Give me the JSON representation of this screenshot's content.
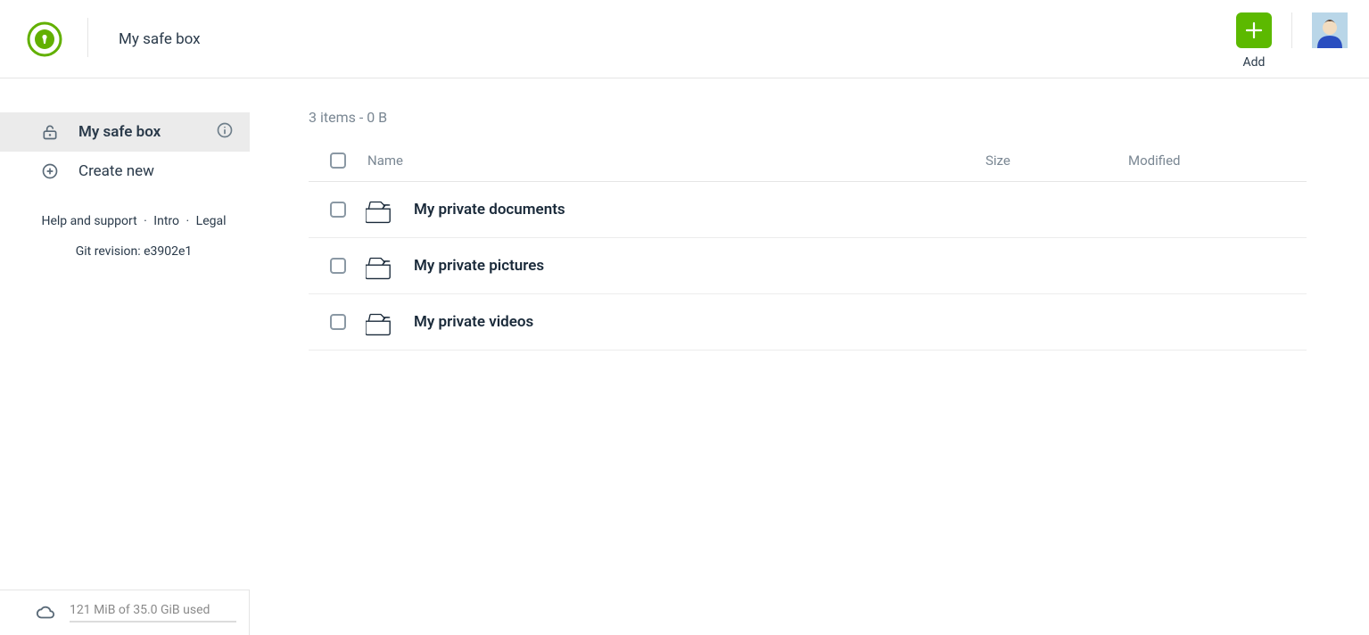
{
  "header": {
    "title": "My safe box",
    "add_label": "Add"
  },
  "sidebar": {
    "items": [
      {
        "label": "My safe box"
      },
      {
        "label": "Create new"
      }
    ],
    "help_label": "Help and support",
    "intro_label": "Intro",
    "legal_label": "Legal",
    "git_label": "Git revision: e3902e1"
  },
  "storage": {
    "text": "121 MiB of 35.0 GiB used"
  },
  "main": {
    "summary": "3 items - 0 B",
    "columns": {
      "name": "Name",
      "size": "Size",
      "modified": "Modified"
    },
    "rows": [
      {
        "name": "My private documents",
        "size": "",
        "modified": ""
      },
      {
        "name": "My private pictures",
        "size": "",
        "modified": ""
      },
      {
        "name": "My private videos",
        "size": "",
        "modified": ""
      }
    ]
  }
}
